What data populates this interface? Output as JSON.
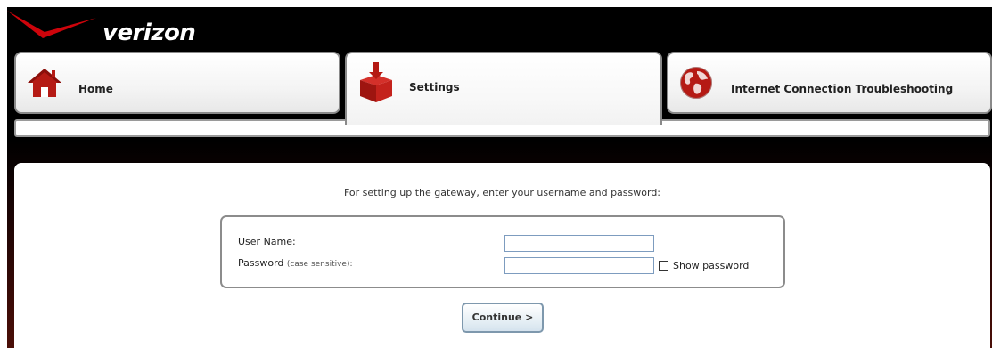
{
  "brand": {
    "logo_text": "verizon",
    "accent_color": "#cd040b"
  },
  "tabs": [
    {
      "label": "Home",
      "icon": "home-icon",
      "active": false
    },
    {
      "label": "Settings",
      "icon": "settings-box-icon",
      "active": true
    },
    {
      "label": "Internet Connection Troubleshooting",
      "icon": "globe-icon",
      "active": false
    }
  ],
  "login": {
    "prompt": "For setting up the gateway, enter your username and password:",
    "username_label": "User Name:",
    "username_value": "",
    "password_label": "Password",
    "password_hint": "(case sensitive):",
    "password_value": "",
    "show_password_label": "Show password",
    "show_password_checked": false,
    "continue_label": "Continue >"
  }
}
